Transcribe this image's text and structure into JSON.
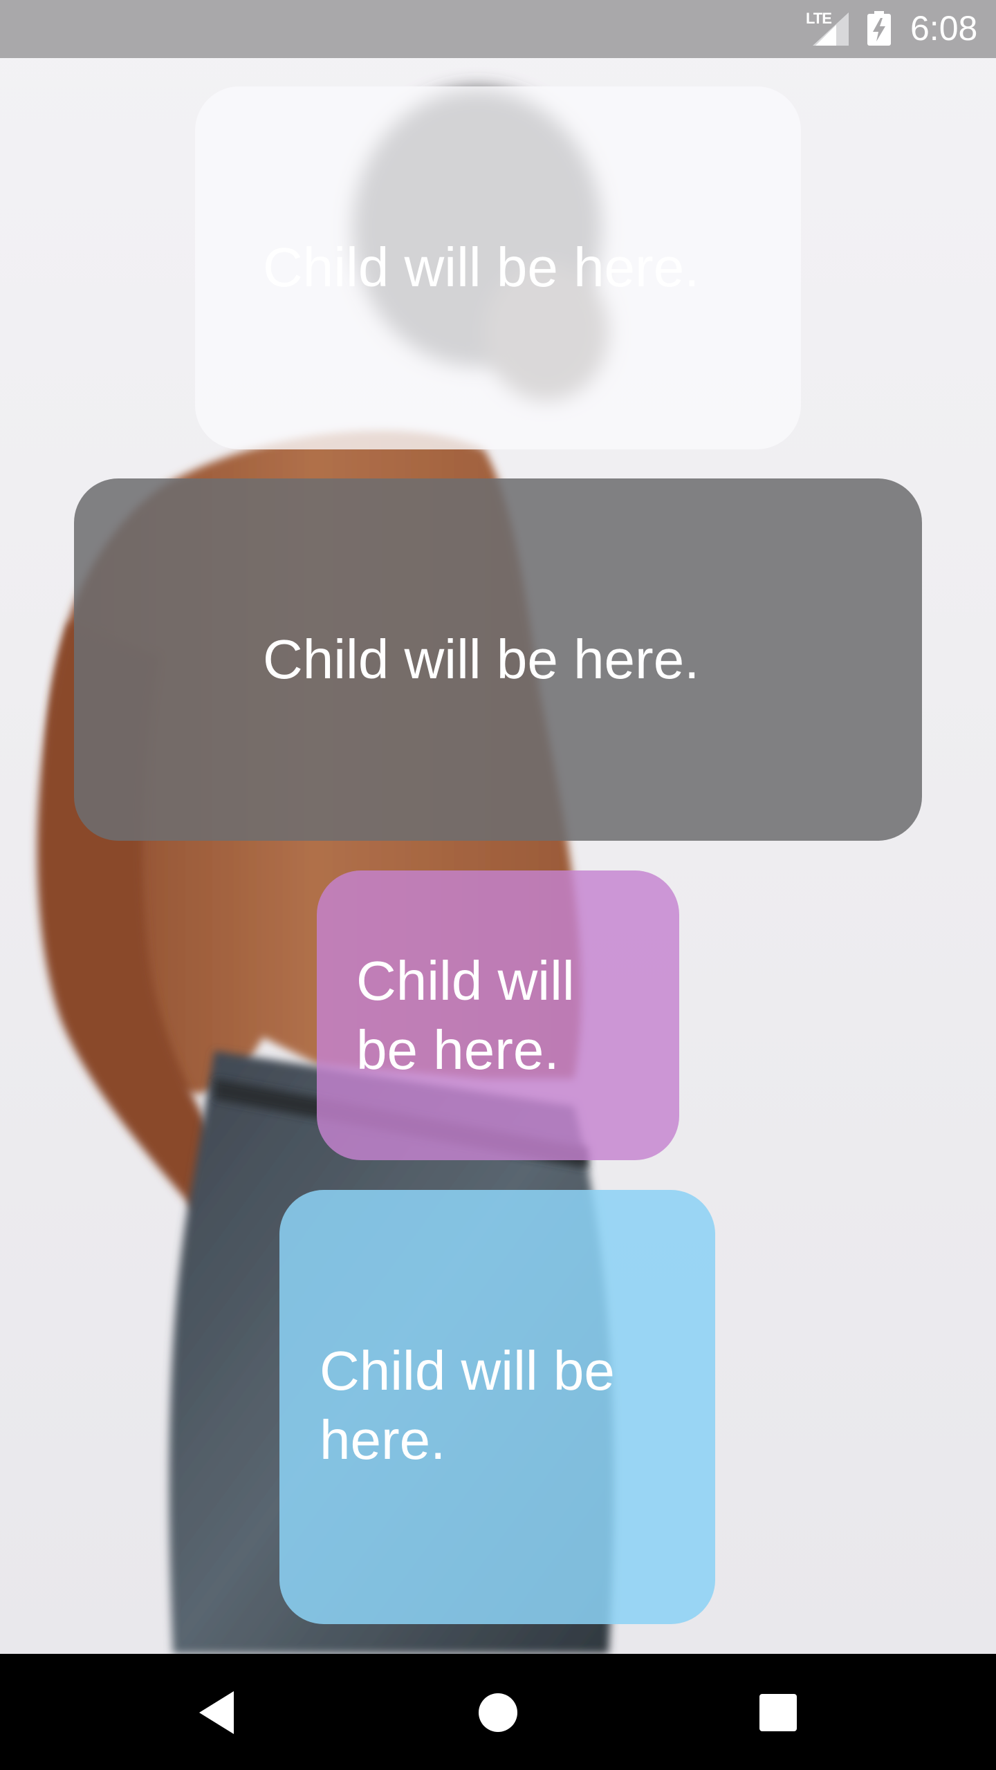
{
  "status_bar": {
    "network_label": "LTE",
    "time": "6:08",
    "icons": [
      "lte-signal-icon",
      "battery-charging-icon"
    ]
  },
  "cards": [
    {
      "text": "Child will be here.",
      "tint": "#f8f8fa"
    },
    {
      "text": "Child will be here.",
      "tint": "#6e6e70"
    },
    {
      "text": "Child will be here.",
      "tint": "#c482d0"
    },
    {
      "text": "Child will be here.",
      "tint": "#8cd2f5"
    }
  ],
  "nav_bar": {
    "icons": [
      "back-icon",
      "home-icon",
      "recents-icon"
    ]
  }
}
